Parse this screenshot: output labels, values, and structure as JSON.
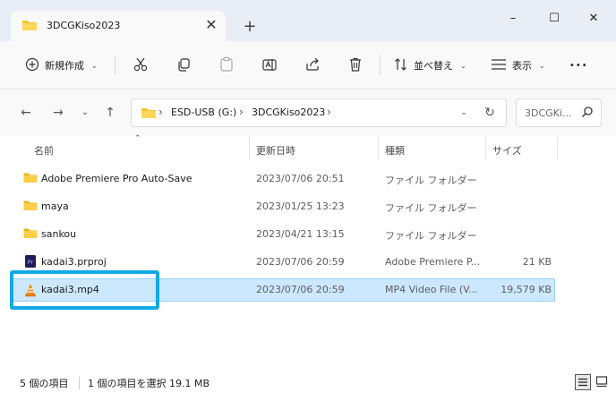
{
  "tab": {
    "title": "3DCGKiso2023",
    "close": "✕",
    "new": "+"
  },
  "window": {
    "minimize": "–",
    "maximize": "☐",
    "close": "✕"
  },
  "toolbar": {
    "new_label": "新規作成",
    "sort_label": "並べ替え",
    "view_label": "表示",
    "more_label": "•••"
  },
  "address": {
    "crumbs": [
      "ESD-USB (G:)",
      "3DCGKiso2023"
    ],
    "separator": "›"
  },
  "search": {
    "placeholder": "3DCGKi..."
  },
  "columns": {
    "name": "名前",
    "date": "更新日時",
    "type": "種類",
    "size": "サイズ"
  },
  "files": [
    {
      "name": "Adobe Premiere Pro Auto-Save",
      "date": "2023/07/06 20:51",
      "type": "ファイル フォルダー",
      "size": "",
      "icon": "folder-icon"
    },
    {
      "name": "maya",
      "date": "2023/01/25 13:23",
      "type": "ファイル フォルダー",
      "size": "",
      "icon": "folder-icon"
    },
    {
      "name": "sankou",
      "date": "2023/04/21 13:15",
      "type": "ファイル フォルダー",
      "size": "",
      "icon": "folder-icon"
    },
    {
      "name": "kadai3.prproj",
      "date": "2023/07/06 20:59",
      "type": "Adobe Premiere P...",
      "size": "21 KB",
      "icon": "premiere-project-icon"
    },
    {
      "name": "kadai3.mp4",
      "date": "2023/07/06 20:59",
      "type": "MP4 Video File (V...",
      "size": "19,579 KB",
      "icon": "vlc-cone-icon",
      "selected": true
    }
  ],
  "status": {
    "count": "5 個の項目",
    "selection": "1 個の項目を選択  19.1 MB"
  },
  "colors": {
    "accent_highlight": "#12a9e6",
    "selection_bg": "#cce8ff",
    "folder_yellow": "#f4c430"
  }
}
